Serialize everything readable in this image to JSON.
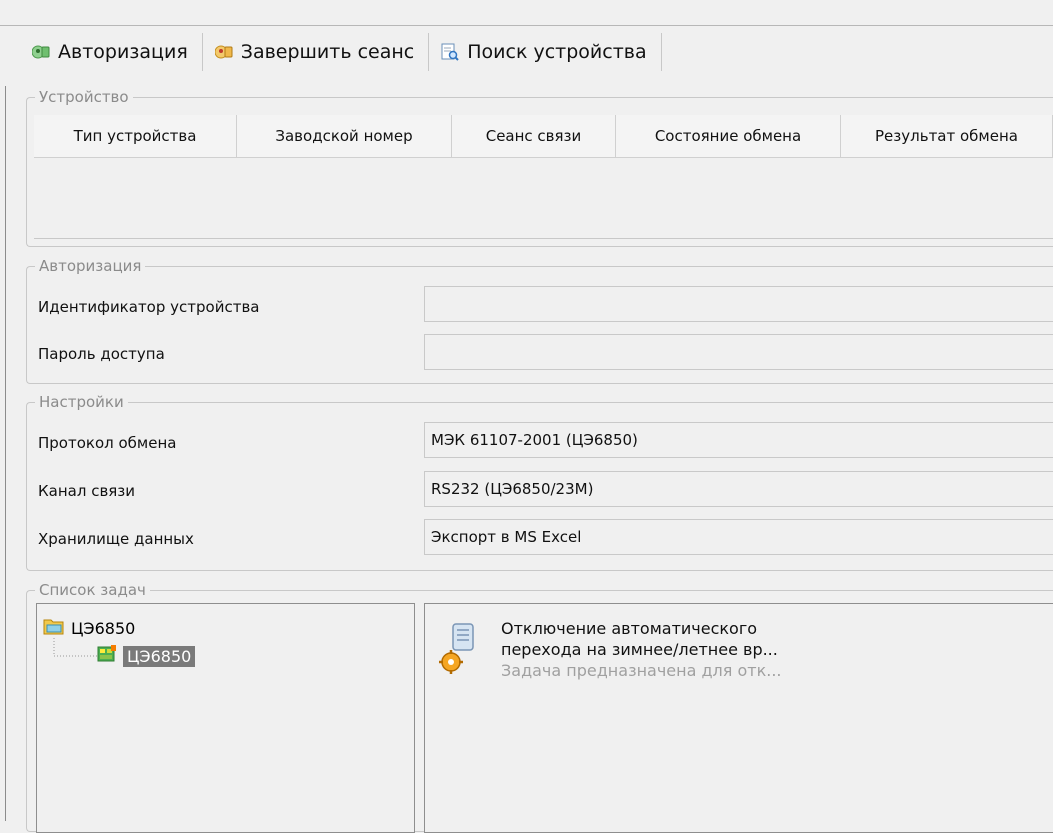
{
  "toolbar": {
    "auth_label": "Авторизация",
    "end_session_label": "Завершить сеанс",
    "find_device_label": "Поиск устройства"
  },
  "device": {
    "legend": "Устройство",
    "columns": [
      "Тип устройства",
      "Заводской номер",
      "Сеанс связи",
      "Состояние обмена",
      "Результат обмена"
    ]
  },
  "auth": {
    "legend": "Авторизация",
    "device_id_label": "Идентификатор устройства",
    "device_id_value": "",
    "password_label": "Пароль доступа",
    "password_value": ""
  },
  "settings": {
    "legend": "Настройки",
    "protocol_label": "Протокол обмена",
    "protocol_value": "МЭК 61107-2001 (ЦЭ6850)",
    "channel_label": "Канал связи",
    "channel_value": "RS232 (ЦЭ6850/23М)",
    "storage_label": "Хранилище данных",
    "storage_value": "Экспорт в MS Excel"
  },
  "tasks": {
    "legend": "Список задач",
    "tree_root": "ЦЭ6850",
    "tree_child": "ЦЭ6850",
    "task_title_line1": "Отключение автоматического",
    "task_title_line2": "перехода на зимнее/летнее вр...",
    "task_desc": "Задача предназначена для отк..."
  }
}
